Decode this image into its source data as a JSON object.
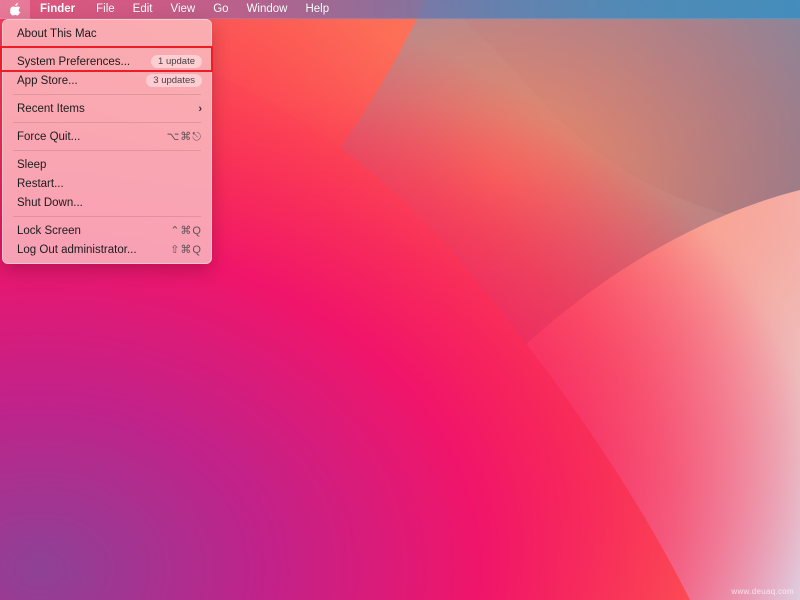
{
  "menubar": {
    "apple_icon": "apple-logo-icon",
    "items": [
      {
        "label": "Finder",
        "bold": true
      },
      {
        "label": "File",
        "bold": false
      },
      {
        "label": "Edit",
        "bold": false
      },
      {
        "label": "View",
        "bold": false
      },
      {
        "label": "Go",
        "bold": false
      },
      {
        "label": "Window",
        "bold": false
      },
      {
        "label": "Help",
        "bold": false
      }
    ]
  },
  "apple_menu": {
    "about": {
      "label": "About This Mac"
    },
    "system_preferences": {
      "label": "System Preferences...",
      "badge": "1 update"
    },
    "app_store": {
      "label": "App Store...",
      "badge": "3 updates"
    },
    "recent_items": {
      "label": "Recent Items",
      "chevron": "›"
    },
    "force_quit": {
      "label": "Force Quit...",
      "shortcut": "⌥⌘⎋"
    },
    "sleep": {
      "label": "Sleep"
    },
    "restart": {
      "label": "Restart..."
    },
    "shut_down": {
      "label": "Shut Down..."
    },
    "lock_screen": {
      "label": "Lock Screen",
      "shortcut": "⌃⌘Q"
    },
    "log_out": {
      "label": "Log Out administrator...",
      "shortcut": "⇧⌘Q"
    }
  },
  "highlight": {
    "target": "System Preferences...",
    "color": "#ee1c25"
  },
  "watermark": {
    "text": "www.deuaq.com"
  },
  "colors": {
    "accent_red": "#ee1c25",
    "wallpaper_pink": "#f5245f",
    "wallpaper_orange": "#fb6a54",
    "wallpaper_blue": "#4ba3d3",
    "wallpaper_purple": "#8b4a9c",
    "menu_panel": "#fac4c8"
  }
}
